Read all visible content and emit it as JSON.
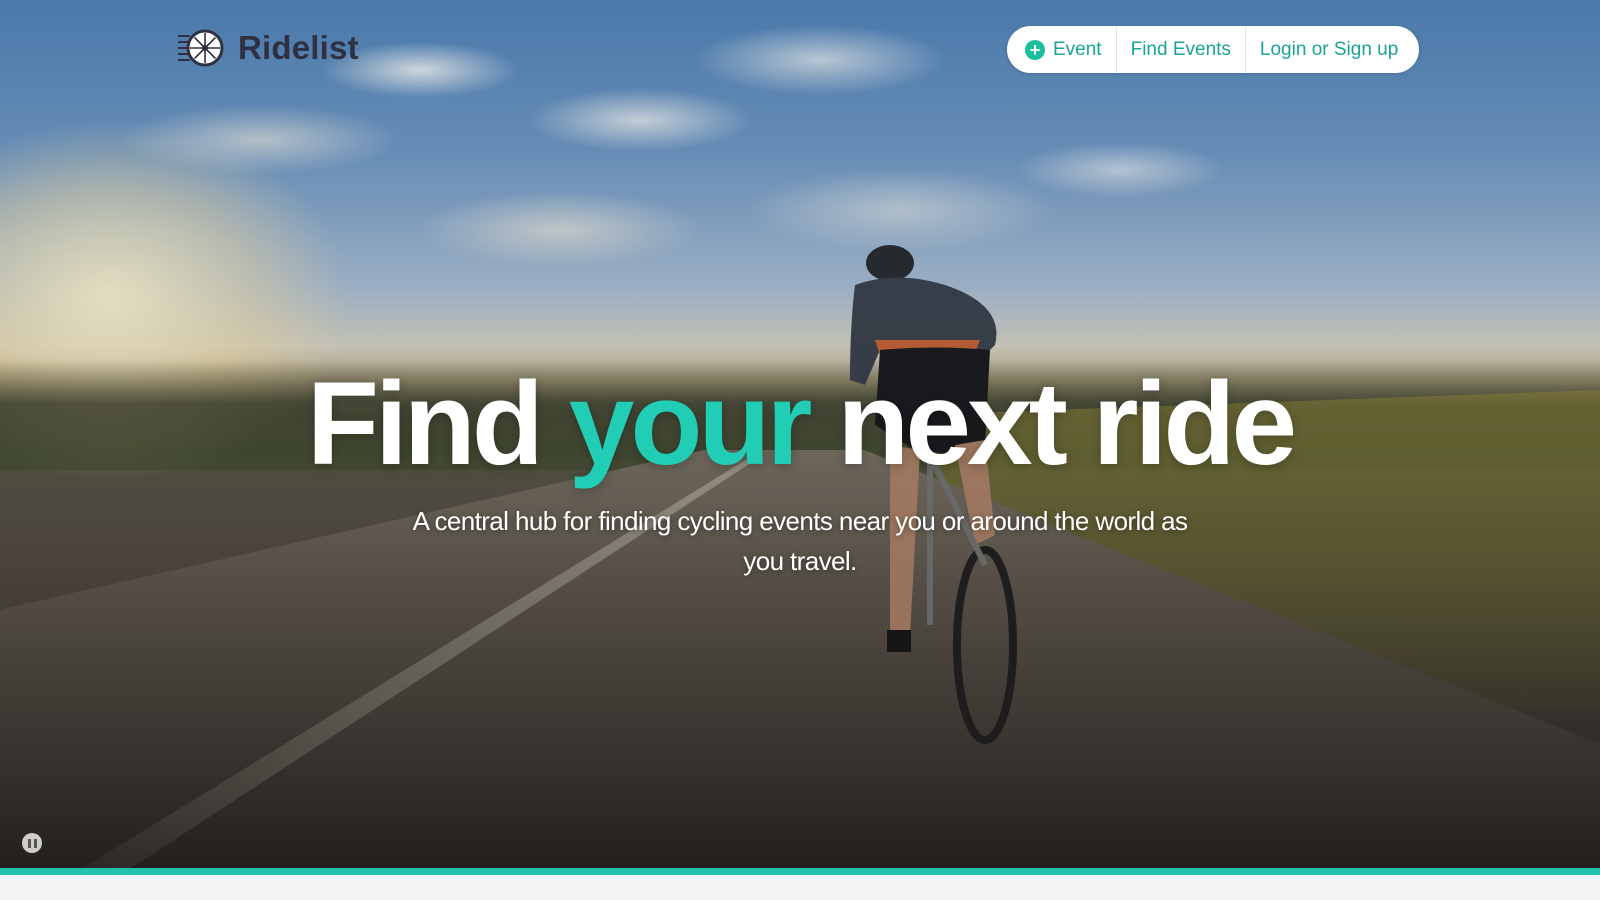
{
  "brand": {
    "name": "Ridelist",
    "icon": "wheel-logo-icon"
  },
  "nav": {
    "items": [
      {
        "label": "Event",
        "icon": "plus-circle-icon"
      },
      {
        "label": "Find Events"
      },
      {
        "label": "Login or Sign up"
      }
    ]
  },
  "hero": {
    "headline_before": "Find",
    "headline_accent": "your",
    "headline_after": "next ride",
    "subheading": "A central hub for finding cycling events near you or around the world as you travel.",
    "video_control": "pause-icon"
  },
  "colors": {
    "accent": "#22cdb5",
    "nav_text": "#1aa496",
    "brand_text": "#2f3142",
    "accent_bar": "#23c2ad"
  }
}
